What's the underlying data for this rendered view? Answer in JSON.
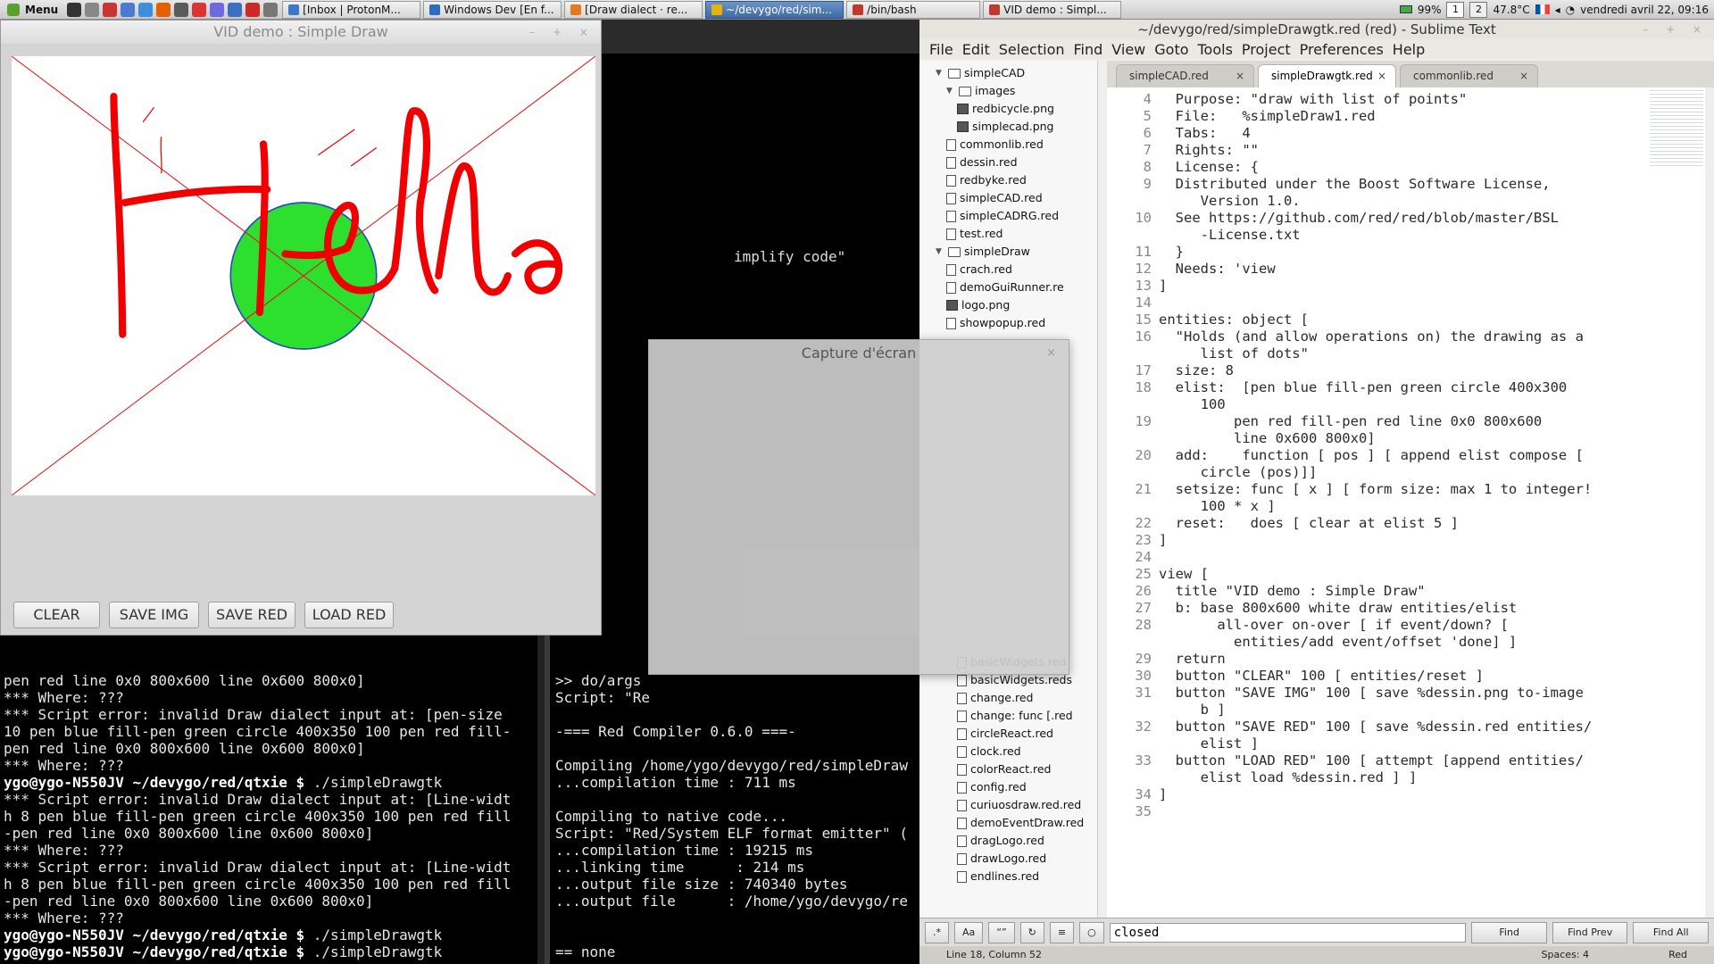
{
  "taskbar": {
    "menu_label": "Menu",
    "tasks": [
      {
        "label": "[Inbox | ProtonM...",
        "color": "#3b78c8"
      },
      {
        "label": "Windows Dev [En f...",
        "color": "#2a6cc2"
      },
      {
        "label": "[Draw dialect · re...",
        "color": "#e87722"
      },
      {
        "label": "~/devygo/red/sim...",
        "color": "#e8b400",
        "active": true
      },
      {
        "label": "/bin/bash",
        "color": "#c0392b"
      },
      {
        "label": "VID demo : Simpl...",
        "color": "#c0392b"
      }
    ],
    "battery": "99%",
    "workspaces": [
      "1",
      "2"
    ],
    "temperature": "47.8°C",
    "clock": "vendredi avril 22, 09:16"
  },
  "vid_window": {
    "title": "VID demo : Simple Draw",
    "buttons": [
      "CLEAR",
      "SAVE IMG",
      "SAVE RED",
      "LOAD RED"
    ]
  },
  "terminal_left": {
    "lines": [
      "pen red line 0x0 800x600 line 0x600 800x0]",
      "*** Where: ???",
      "*** Script error: invalid Draw dialect input at: [pen-size",
      "10 pen blue fill-pen green circle 400x350 100 pen red fill-",
      "pen red line 0x0 800x600 line 0x600 800x0]",
      "*** Where: ???",
      "$PROMPT ./simpleDrawgtk",
      "*** Script error: invalid Draw dialect input at: [Line-widt",
      "h 8 pen blue fill-pen green circle 400x350 100 pen red fill",
      "-pen red line 0x0 800x600 line 0x600 800x0]",
      "*** Where: ???",
      "*** Script error: invalid Draw dialect input at: [Line-widt",
      "h 8 pen blue fill-pen green circle 400x350 100 pen red fill",
      "-pen red line 0x0 800x600 line 0x600 800x0]",
      "*** Where: ???",
      "$PROMPT ./simpleDrawgtk",
      "$PROMPT ./simpleDrawgtk"
    ],
    "prompt": "ygo@ygo-N550JV ~/devygo/red/qtxie $"
  },
  "terminal_right": {
    "lines": [
      ">> do/args",
      "Script: \"Re",
      "",
      "-=== Red Compiler 0.6.0 ===-",
      "",
      "Compiling /home/ygo/devygo/red/simpleDraw",
      "...compilation time : 711 ms",
      "",
      "Compiling to native code...",
      "Script: \"Red/System ELF format emitter\" (",
      "...compilation time : 19215 ms",
      "...linking time      : 214 ms",
      "...output file size : 740340 bytes",
      "...output file      : /home/ygo/devygo/re",
      "",
      "",
      "== none",
      ">> "
    ]
  },
  "terminal_mid": {
    "text": "implify code\""
  },
  "dialog": {
    "title": "Capture d'écran"
  },
  "sublime": {
    "title": "~/devygo/red/simpleDrawgtk.red (red) - Sublime Text",
    "menu": [
      "File",
      "Edit",
      "Selection",
      "Find",
      "View",
      "Goto",
      "Tools",
      "Project",
      "Preferences",
      "Help"
    ],
    "tabs": [
      "simpleCAD.red",
      "simpleDrawgtk.red",
      "commonlib.red"
    ],
    "sidebar": [
      {
        "label": "simpleCAD",
        "type": "folder",
        "indent": 1
      },
      {
        "label": "images",
        "type": "folder",
        "indent": 2
      },
      {
        "label": "redbicycle.png",
        "type": "image",
        "indent": 3
      },
      {
        "label": "simplecad.png",
        "type": "image",
        "indent": 3
      },
      {
        "label": "commonlib.red",
        "type": "file",
        "indent": 2
      },
      {
        "label": "dessin.red",
        "type": "file",
        "indent": 2
      },
      {
        "label": "redbyke.red",
        "type": "file",
        "indent": 2
      },
      {
        "label": "simpleCAD.red",
        "type": "file",
        "indent": 2
      },
      {
        "label": "simpleCADRG.red",
        "type": "file",
        "indent": 2
      },
      {
        "label": "test.red",
        "type": "file",
        "indent": 2
      },
      {
        "label": "simpleDraw",
        "type": "folder",
        "indent": 1
      },
      {
        "label": "crach.red",
        "type": "file",
        "indent": 2
      },
      {
        "label": "demoGuiRunner.re",
        "type": "file",
        "indent": 2
      },
      {
        "label": "logo.png",
        "type": "image",
        "indent": 2
      },
      {
        "label": "showpopup.red",
        "type": "file",
        "indent": 2
      }
    ],
    "sidebar_bottom": [
      "basicWidgets.red",
      "basicWidgets.reds",
      "change.red",
      "change: func [.red",
      "circleReact.red",
      "clock.red",
      "colorReact.red",
      "config.red",
      "curiuosdraw.red.red",
      "demoEventDraw.red",
      "dragLogo.red",
      "drawLogo.red",
      "endlines.red"
    ],
    "find_value": "closed",
    "find_buttons": [
      "Find",
      "Find Prev",
      "Find All"
    ],
    "status_left": "Line 18, Column 52",
    "status_spaces": "Spaces: 4",
    "status_syntax": "Red"
  },
  "code_lines": [
    {
      "n": "4",
      "t": "  Purpose: \"draw with list of points\""
    },
    {
      "n": "5",
      "t": "  File:   %simpleDraw1.red"
    },
    {
      "n": "6",
      "t": "  Tabs:   4"
    },
    {
      "n": "7",
      "t": "  Rights: \"\""
    },
    {
      "n": "8",
      "t": "  License: {"
    },
    {
      "n": "9",
      "t": "  Distributed under the Boost Software License,"
    },
    {
      "n": "",
      "t": "     Version 1.0."
    },
    {
      "n": "10",
      "t": "  See https://github.com/red/red/blob/master/BSL"
    },
    {
      "n": "",
      "t": "     -License.txt"
    },
    {
      "n": "11",
      "t": "  }"
    },
    {
      "n": "12",
      "t": "  Needs: 'view"
    },
    {
      "n": "13",
      "t": "]"
    },
    {
      "n": "14",
      "t": ""
    },
    {
      "n": "15",
      "t": "entities: object ["
    },
    {
      "n": "16",
      "t": "  \"Holds (and allow operations on) the drawing as a"
    },
    {
      "n": "",
      "t": "     list of dots\""
    },
    {
      "n": "17",
      "t": "  size: 8"
    },
    {
      "n": "18",
      "t": "  elist:  [pen blue fill-pen green circle 400x300"
    },
    {
      "n": "",
      "t": "     100"
    },
    {
      "n": "19",
      "t": "         pen red fill-pen red line 0x0 800x600"
    },
    {
      "n": "",
      "t": "         line 0x600 800x0]"
    },
    {
      "n": "20",
      "t": "  add:    function [ pos ] [ append elist compose ["
    },
    {
      "n": "",
      "t": "     circle (pos)]]"
    },
    {
      "n": "21",
      "t": "  setsize: func [ x ] [ form size: max 1 to integer!"
    },
    {
      "n": "",
      "t": "     100 * x ]"
    },
    {
      "n": "22",
      "t": "  reset:   does [ clear at elist 5 ]"
    },
    {
      "n": "23",
      "t": "]"
    },
    {
      "n": "24",
      "t": ""
    },
    {
      "n": "25",
      "t": "view ["
    },
    {
      "n": "26",
      "t": "  title \"VID demo : Simple Draw\""
    },
    {
      "n": "27",
      "t": "  b: base 800x600 white draw entities/elist"
    },
    {
      "n": "28",
      "t": "       all-over on-over [ if event/down? ["
    },
    {
      "n": "",
      "t": "         entities/add event/offset 'done] ]"
    },
    {
      "n": "29",
      "t": "  return"
    },
    {
      "n": "30",
      "t": "  button \"CLEAR\" 100 [ entities/reset ]"
    },
    {
      "n": "31",
      "t": "  button \"SAVE IMG\" 100 [ save %dessin.png to-image"
    },
    {
      "n": "",
      "t": "     b ]"
    },
    {
      "n": "32",
      "t": "  button \"SAVE RED\" 100 [ save %dessin.red entities/"
    },
    {
      "n": "",
      "t": "     elist ]"
    },
    {
      "n": "33",
      "t": "  button \"LOAD RED\" 100 [ attempt [append entities/"
    },
    {
      "n": "",
      "t": "     elist load %dessin.red ] ]"
    },
    {
      "n": "34",
      "t": "]"
    },
    {
      "n": "35",
      "t": ""
    }
  ]
}
